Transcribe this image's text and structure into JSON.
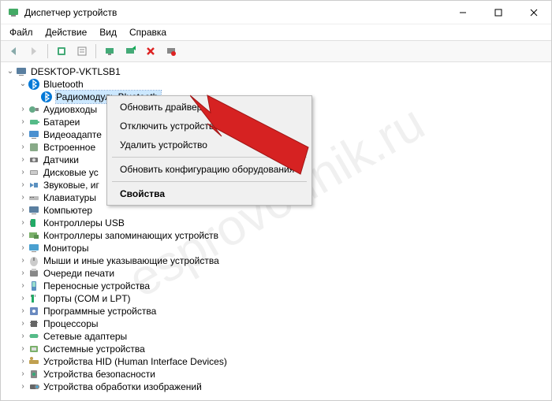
{
  "window": {
    "title": "Диспетчер устройств"
  },
  "menu": {
    "file": "Файл",
    "action": "Действие",
    "view": "Вид",
    "help": "Справка"
  },
  "tree": {
    "root": "DESKTOP-VKTLSB1",
    "bluetooth": "Bluetooth",
    "bt_radio": "Радиомодуль Bluetooth",
    "items": [
      "Аудиовходы",
      "Батареи",
      "Видеоадапте",
      "Встроенное",
      "Датчики",
      "Дисковые ус",
      "Звуковые, иг",
      "Клавиатуры",
      "Компьютер",
      "Контроллеры USB",
      "Контроллеры запоминающих устройств",
      "Мониторы",
      "Мыши и иные указывающие устройства",
      "Очереди печати",
      "Переносные устройства",
      "Порты (COM и LPT)",
      "Программные устройства",
      "Процессоры",
      "Сетевые адаптеры",
      "Системные устройства",
      "Устройства HID (Human Interface Devices)",
      "Устройства безопасности",
      "Устройства обработки изображений"
    ]
  },
  "context": {
    "update_driver": "Обновить драйвер",
    "disable_device": "Отключить устройство",
    "remove_device": "Удалить устройство",
    "scan_hardware": "Обновить конфигурацию оборудования",
    "properties": "Свойства"
  },
  "watermark": "esprovodnik.ru",
  "icon_colors": {
    "bluetooth": "#0078d7",
    "accent_red": "#d62222"
  }
}
